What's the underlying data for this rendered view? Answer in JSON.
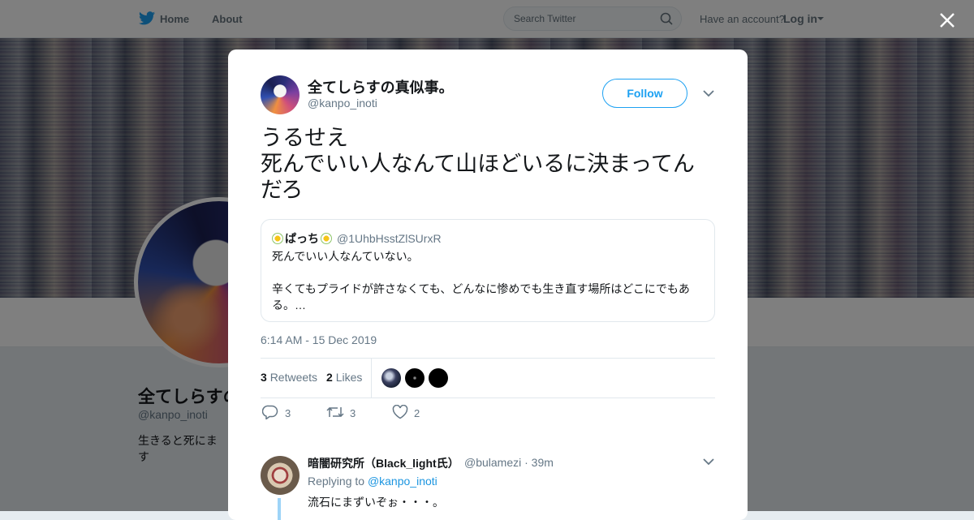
{
  "nav": {
    "home": "Home",
    "about": "About",
    "search_placeholder": "Search Twitter",
    "have_account": "Have an account?",
    "login": "Log in"
  },
  "background_profile": {
    "name": "全てしらすの",
    "handle": "@kanpo_inoti",
    "bio": "生きると死にます"
  },
  "tweet": {
    "author_name": "全てしらすの真似事。",
    "author_handle": "@kanpo_inoti",
    "follow_label": "Follow",
    "text": "うるせえ\n死んでいい人なんて山ほどいるに決まってんだろ",
    "quote": {
      "name": "ぱっち",
      "handle": "@1UhbHsstZlSUrxR",
      "text": "死んでいい人なんていない。\n\n辛くてもプライドが許さなくても、どんなに惨めでも生き直す場所はどこにでもある。…"
    },
    "timestamp": "6:14 AM - 15 Dec 2019",
    "stats": {
      "retweets_count": "3",
      "retweets_label": "Retweets",
      "likes_count": "2",
      "likes_label": "Likes"
    },
    "actions": {
      "reply_count": "3",
      "retweet_count": "3",
      "like_count": "2"
    }
  },
  "reply": {
    "name": "暗闇研究所（Black_light氏）",
    "meta": "@bulamezi · 39m",
    "replying_prefix": "Replying to",
    "replying_to": "@kanpo_inoti",
    "text": "流石にまずいぞぉ・・・。"
  },
  "colors": {
    "accent": "#1da1f2",
    "text_secondary": "#657786"
  },
  "icons": [
    "twitter-bird-icon",
    "search-icon",
    "close-icon",
    "chevron-down-icon",
    "reply-icon",
    "retweet-icon",
    "heart-icon"
  ]
}
